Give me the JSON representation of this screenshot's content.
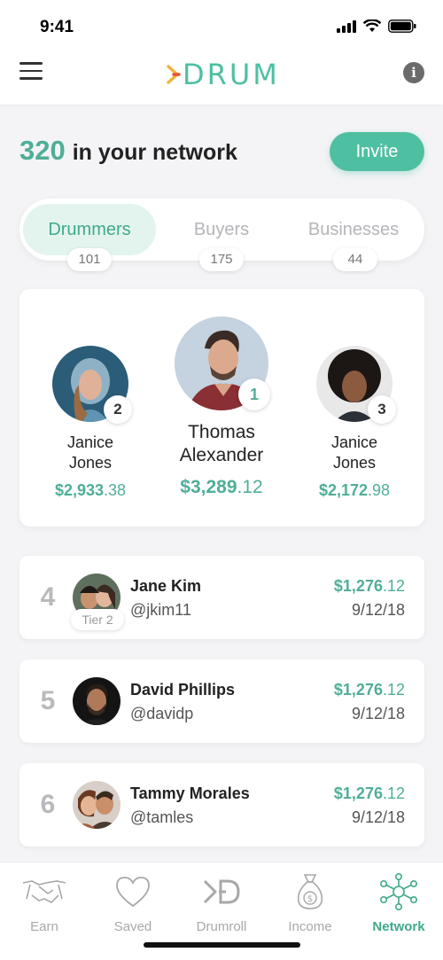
{
  "status": {
    "time": "9:41"
  },
  "header": {
    "logo_text": "DRUM",
    "brand_color": "#4fbfa2"
  },
  "network": {
    "count": "320",
    "label": "in your network",
    "invite_label": "Invite"
  },
  "tabs": [
    {
      "label": "Drummers",
      "count": "101",
      "active": true
    },
    {
      "label": "Buyers",
      "count": "175",
      "active": false
    },
    {
      "label": "Businesses",
      "count": "44",
      "active": false
    }
  ],
  "podium": {
    "first": {
      "rank": "1",
      "name_line1": "Thomas",
      "name_line2": "Alexander",
      "amount": "$3,289",
      "cents": ".12"
    },
    "second": {
      "rank": "2",
      "name_line1": "Janice",
      "name_line2": "Jones",
      "amount": "$2,933",
      "cents": ".38"
    },
    "third": {
      "rank": "3",
      "name_line1": "Janice",
      "name_line2": "Jones",
      "amount": "$2,172",
      "cents": ".98"
    }
  },
  "list": [
    {
      "rank": "4",
      "name": "Jane Kim",
      "handle": "@jkim11",
      "amount": "$1,276",
      "cents": ".12",
      "date": "9/12/18",
      "tier": "Tier 2"
    },
    {
      "rank": "5",
      "name": "David Phillips",
      "handle": "@davidp",
      "amount": "$1,276",
      "cents": ".12",
      "date": "9/12/18"
    },
    {
      "rank": "6",
      "name": "Tammy Morales",
      "handle": "@tamles",
      "amount": "$1,276",
      "cents": ".12",
      "date": "9/12/18"
    }
  ],
  "tabbar": [
    {
      "label": "Earn",
      "icon": "handshake-icon"
    },
    {
      "label": "Saved",
      "icon": "heart-icon"
    },
    {
      "label": "Drumroll",
      "icon": "drum-logo-icon"
    },
    {
      "label": "Income",
      "icon": "money-bag-icon"
    },
    {
      "label": "Network",
      "icon": "network-icon",
      "active": true
    }
  ]
}
